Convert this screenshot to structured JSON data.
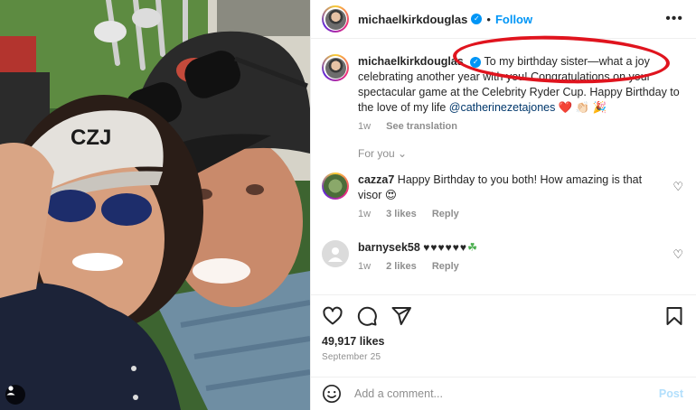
{
  "photo": {
    "visor_text": "CZJ"
  },
  "post": {
    "username": "michaelkirkdouglas",
    "follow_label": "Follow",
    "more_label": "•••",
    "caption": {
      "username": "michaelkirkdouglas",
      "text_part1": "To my birthday sister—what a joy celebrating another year with you! Congratulations on your spectacular game at the Celebrity Ryder Cup. Happy Birthday to the love of my life ",
      "mention": "@catherinezetajones",
      "emojis": " ❤️ 👏🏻 🎉",
      "time": "1w",
      "see_translation": "See translation"
    },
    "for_you_label": "For you ⌄",
    "comments": [
      {
        "username": "cazza7",
        "text": "Happy Birthday to you both! How amazing is that visor 😍",
        "time": "1w",
        "likes": "3 likes",
        "reply": "Reply"
      },
      {
        "username": "barnysek58",
        "text": "♥♥♥♥♥♥",
        "text_extra": "☘",
        "time": "1w",
        "likes": "2 likes",
        "reply": "Reply"
      }
    ],
    "likes_count": "49,917 likes",
    "date": "September 25",
    "add_comment_placeholder": "Add a comment...",
    "post_label": "Post"
  },
  "colors": {
    "accent": "#0095f6",
    "annotation": "#e0141e",
    "mention": "#00376b"
  },
  "icons": [
    "heart-icon",
    "comment-icon",
    "share-icon",
    "bookmark-icon",
    "emoji-icon",
    "verified-icon",
    "more-icon",
    "tag-user-icon"
  ]
}
